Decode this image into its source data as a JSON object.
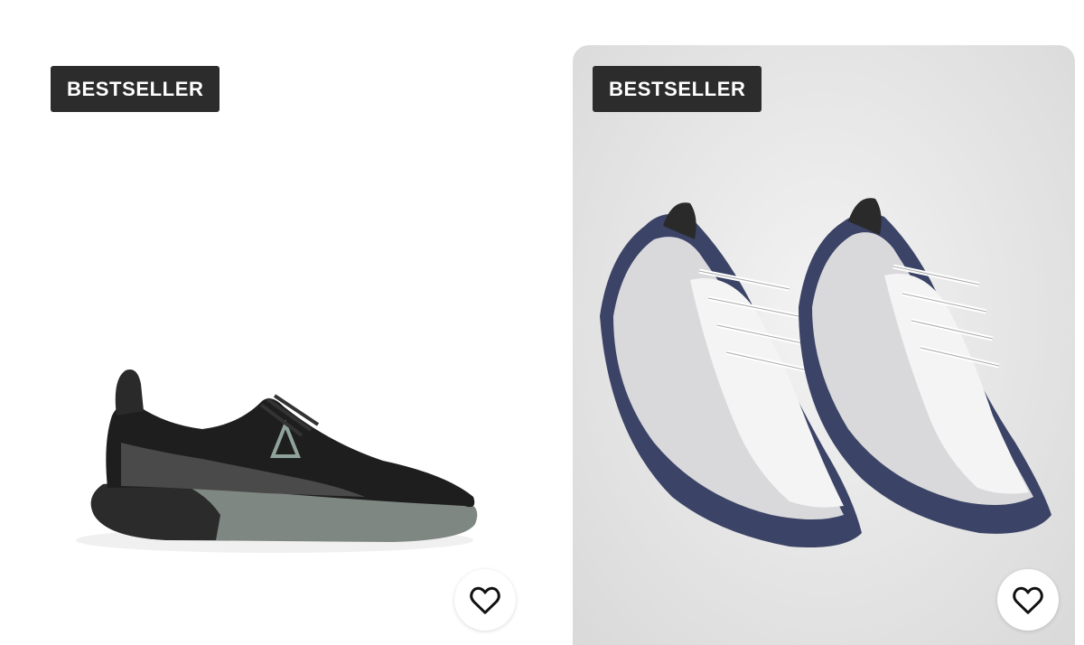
{
  "products": [
    {
      "badge": "BESTSELLER",
      "image_icon": "black-running-sneaker-image",
      "wishlist_icon": "heart-outline-icon"
    },
    {
      "badge": "BESTSELLER",
      "image_icon": "silver-navy-chunky-sneakers-image",
      "wishlist_icon": "heart-outline-icon"
    }
  ],
  "colors": {
    "badge_background": "#2c2c2c",
    "badge_text": "#ffffff",
    "card_right_background": "#e3e3e3"
  }
}
